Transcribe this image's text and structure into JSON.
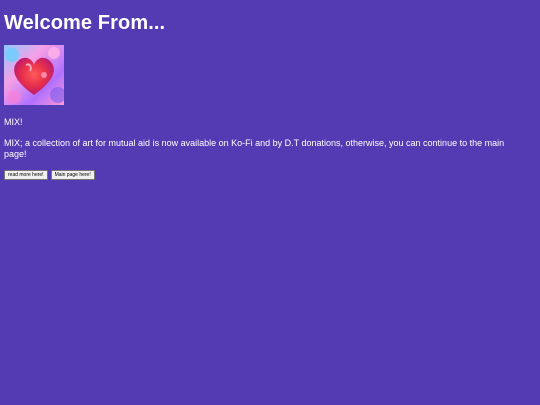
{
  "heading": "Welcome From...",
  "image": {
    "icon": "abstract-heart-artwork",
    "colors": [
      "#ff6fa8",
      "#e83a3a",
      "#7a6cf0",
      "#39c2ff",
      "#ffd1f0"
    ]
  },
  "intro_title": "MIX!",
  "intro_text": "MIX; a collection of art for mutual aid is now available on Ko-Fi and by D.T donations, otherwise, you can continue to the main page!",
  "buttons": {
    "read_more": "read more here!",
    "main_page": "Main page here!"
  },
  "colors": {
    "background": "#533cb3",
    "text": "#ffffff"
  }
}
